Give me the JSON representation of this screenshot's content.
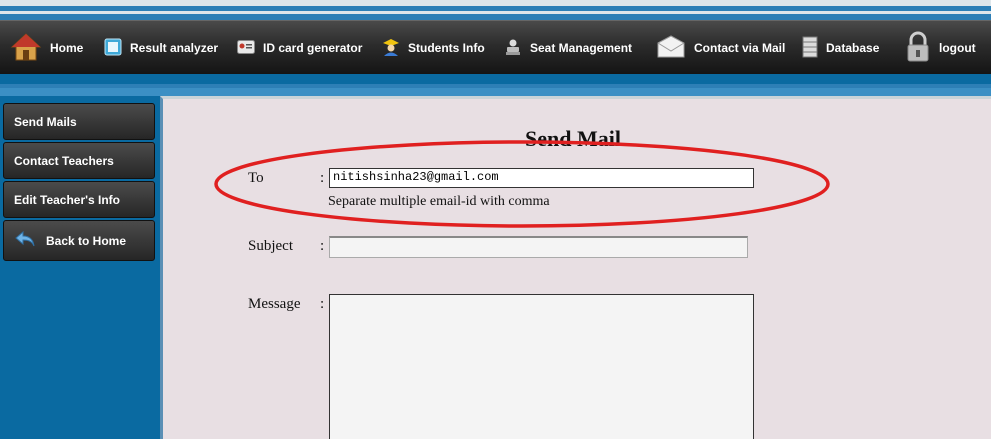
{
  "nav": {
    "items": [
      {
        "label": "Home",
        "icon": "house-icon"
      },
      {
        "label": "Result analyzer",
        "icon": "result-icon"
      },
      {
        "label": "ID card generator",
        "icon": "id-card-icon"
      },
      {
        "label": "Students Info",
        "icon": "student-icon"
      },
      {
        "label": "Seat Management",
        "icon": "seat-icon"
      },
      {
        "label": "Contact via Mail",
        "icon": "envelope-icon"
      },
      {
        "label": "Database",
        "icon": "database-icon"
      },
      {
        "label": "logout",
        "icon": "lock-icon"
      }
    ]
  },
  "sidebar": {
    "items": [
      {
        "label": "Send Mails"
      },
      {
        "label": "Contact Teachers"
      },
      {
        "label": "Edit Teacher's Info"
      },
      {
        "label": "Back to Home",
        "icon": "back-arrow-icon"
      }
    ]
  },
  "form": {
    "title": "Send Mail",
    "to_label": "To",
    "to_value": "nitishsinha23@gmail.com",
    "to_hint": "Separate multiple email-id with comma",
    "subject_label": "Subject",
    "subject_value": "",
    "message_label": "Message",
    "message_value": "",
    "colon": ":"
  },
  "colors": {
    "annotation_oval": "#e02020",
    "background_blue": "#0a6aa1",
    "panel": "#e8dfe3"
  }
}
